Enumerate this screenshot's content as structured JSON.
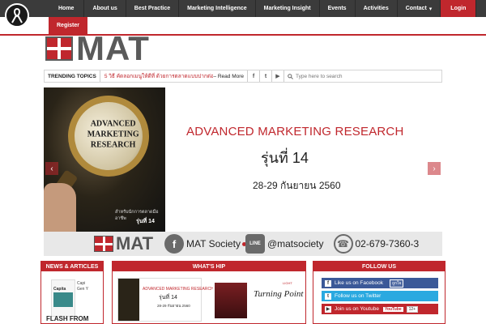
{
  "nav": {
    "items": [
      "Home",
      "About us",
      "Best Practice",
      "Marketing Intelligence",
      "Marketing Insight",
      "Events",
      "Activities",
      "Contact"
    ],
    "contact_caret": "▾",
    "login": "Login",
    "register": "Register"
  },
  "brand": {
    "logo_text": "MAT"
  },
  "trending": {
    "label": "TRENDING TOPICS",
    "headline": "5 วิธี คัดลอกเมนูให้ดีที่ ด้วยการตลาดแบบปากต่อปาก",
    "read_more": "– Read More",
    "social": [
      "f",
      "t",
      "▶"
    ],
    "search_placeholder": "Type here to search"
  },
  "slider": {
    "image_text": "ADVANCED MARKETING RESEARCH",
    "image_caption1": "สำหรับนักการตลาดมืออาชีพ",
    "image_caption2": "รุ่นที่ 14",
    "title": "ADVANCED MARKETING RESEARCH",
    "subtitle": "รุ่นที่ 14",
    "date": "28-29 กันยายน 2560",
    "prev": "‹",
    "next": "›"
  },
  "contact": {
    "logo_text": "MAT",
    "facebook_icon": "f",
    "facebook_name": "MAT Society",
    "line_icon": "LINE",
    "line_id": "@matsociety",
    "phone_icon": "☎",
    "phone": "02-679-7360-3",
    "dot_colors": [
      "#c0272d",
      "#bbbbbb"
    ]
  },
  "widgets": {
    "news": {
      "title": "NEWS & ARTICLES",
      "book_title": "Capita",
      "side_text": "Capi\nGen Y",
      "bottom_text": "FLASH FROM"
    },
    "hip": {
      "title": "WHAT'S HIP",
      "card1_title": "ADVANCED MARKETING RESEARCH",
      "card1_sub": "รุ่นที่ 14",
      "card1_date": "28-29 กันยายน 2560",
      "card2_tag": "LIGHT",
      "card2_text": "Turning Point"
    },
    "follow": {
      "title": "FOLLOW US",
      "facebook": "Like us on Facebook",
      "facebook_like": "ถูกใจ",
      "twitter": "Follow us on Twitter",
      "youtube": "Join us on Youtube",
      "youtube_badge": "YouTube",
      "youtube_count": "12+"
    }
  },
  "colors": {
    "accent": "#c0272d",
    "nav_bg": "#3b3b3b",
    "facebook": "#3b5998",
    "twitter": "#2aa9e0"
  },
  "icons": {
    "ribbon": "ribbon-icon",
    "search": "search-icon"
  }
}
